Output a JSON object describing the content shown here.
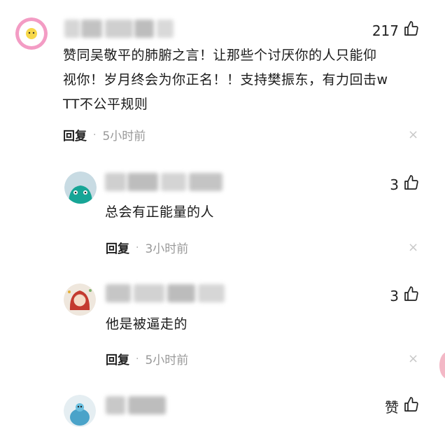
{
  "comments": [
    {
      "likes": "217",
      "text": "赞同吴敬平的肺腑之言！让那些个讨厌你的人只能仰视你！岁月终会为你正名！！支持樊振东，有力回击wTT不公平规则",
      "lines": [
        "赞同吴敬平的肺腑之言！让那些个讨厌你的人只能仰",
        "视你！岁月终会为你正名！！支持樊振东，有力回击w",
        "TT不公平规则"
      ],
      "reply_label": "回复",
      "time": "5小时前",
      "close": "×",
      "avatar": "cartoon-egg-avatar"
    },
    {
      "likes": "3",
      "text": "总会有正能量的人",
      "reply_label": "回复",
      "time": "3小时前",
      "close": "×",
      "avatar": "teal-monster-avatar"
    },
    {
      "likes": "3",
      "text": "他是被逼走的",
      "reply_label": "回复",
      "time": "5小时前",
      "close": "×",
      "avatar": "girl-illustration-avatar"
    },
    {
      "likes": "赞",
      "avatar": "blue-cartoon-avatar"
    }
  ],
  "icons": {
    "like": "thumbs-up-icon",
    "close": "close-icon"
  },
  "colors": {
    "time": "#999999",
    "accent_pink": "#f08fb8",
    "teal": "#1aa89a"
  }
}
